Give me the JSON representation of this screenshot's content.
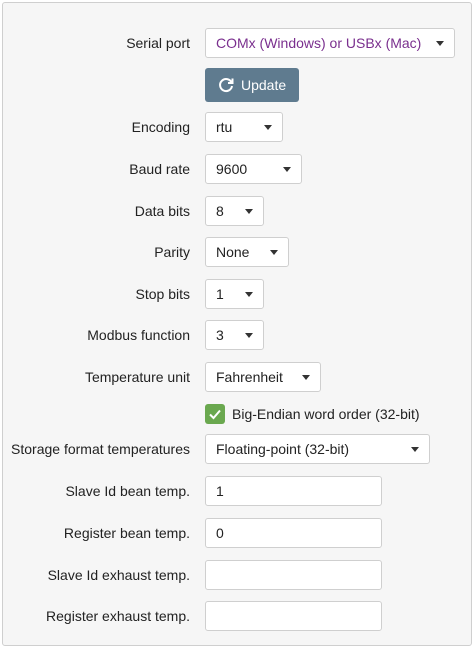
{
  "serial_port": {
    "label": "Serial port",
    "value": "COMx (Windows) or USBx (Mac)"
  },
  "update_button": {
    "label": "Update",
    "icon": "refresh-icon"
  },
  "encoding": {
    "label": "Encoding",
    "value": "rtu"
  },
  "baud_rate": {
    "label": "Baud rate",
    "value": "9600"
  },
  "data_bits": {
    "label": "Data bits",
    "value": "8"
  },
  "parity": {
    "label": "Parity",
    "value": "None"
  },
  "stop_bits": {
    "label": "Stop bits",
    "value": "1"
  },
  "modbus_function": {
    "label": "Modbus function",
    "value": "3"
  },
  "temperature_unit": {
    "label": "Temperature unit",
    "value": "Fahrenheit"
  },
  "big_endian": {
    "label": "Big-Endian word order (32-bit)",
    "checked": true
  },
  "storage_format": {
    "label": "Storage format temperatures",
    "value": "Floating-point (32-bit)"
  },
  "slave_id_bean": {
    "label": "Slave Id bean temp.",
    "value": "1"
  },
  "register_bean": {
    "label": "Register bean temp.",
    "value": "0"
  },
  "slave_id_exhaust": {
    "label": "Slave Id exhaust temp.",
    "value": ""
  },
  "register_exhaust": {
    "label": "Register exhaust temp.",
    "value": ""
  },
  "colors": {
    "accent_button": "#5f7b8f",
    "checkbox": "#6aa84f",
    "serial_port_text": "#7a2f8e"
  }
}
